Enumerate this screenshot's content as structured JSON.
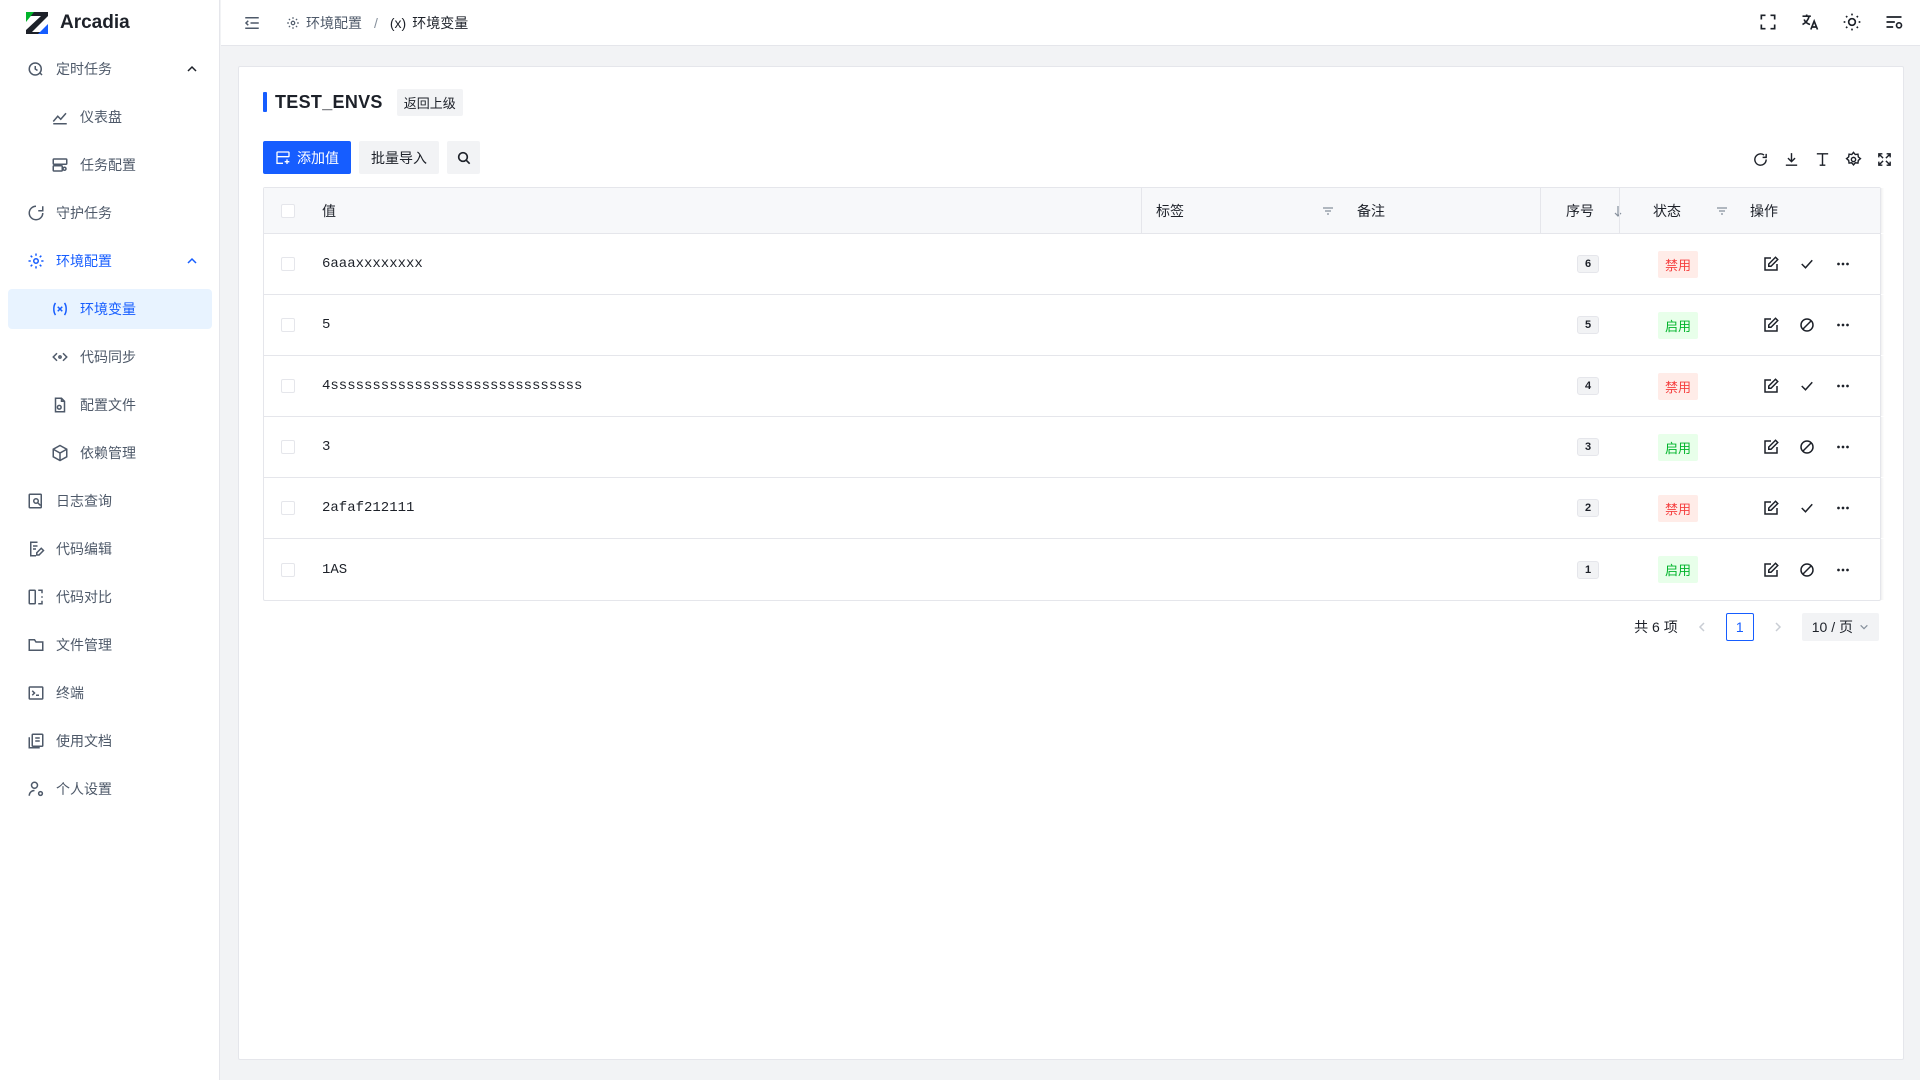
{
  "app": {
    "name": "Arcadia"
  },
  "sidebar": {
    "items": [
      {
        "label": "定时任务",
        "icon": "clock-icon"
      },
      {
        "label": "仪表盘",
        "icon": "chart-line-icon"
      },
      {
        "label": "任务配置",
        "icon": "server-icon"
      },
      {
        "label": "守护任务",
        "icon": "shield-icon"
      },
      {
        "label": "环境配置",
        "icon": "gear-icon"
      },
      {
        "label": "环境变量",
        "icon": "variable-icon"
      },
      {
        "label": "代码同步",
        "icon": "code-sync-icon"
      },
      {
        "label": "配置文件",
        "icon": "file-gear-icon"
      },
      {
        "label": "依赖管理",
        "icon": "package-icon"
      },
      {
        "label": "日志查询",
        "icon": "log-search-icon"
      },
      {
        "label": "代码编辑",
        "icon": "code-edit-icon"
      },
      {
        "label": "代码对比",
        "icon": "diff-icon"
      },
      {
        "label": "文件管理",
        "icon": "folder-icon"
      },
      {
        "label": "终端",
        "icon": "terminal-icon"
      },
      {
        "label": "使用文档",
        "icon": "docs-icon"
      },
      {
        "label": "个人设置",
        "icon": "user-gear-icon"
      }
    ]
  },
  "breadcrumb": {
    "parent": "环境配置",
    "current": "环境变量",
    "current_prefix": "(x)"
  },
  "page": {
    "title": "TEST_ENVS",
    "back_label": "返回上级"
  },
  "toolbar": {
    "add_label": "添加值",
    "import_label": "批量导入"
  },
  "table": {
    "headers": {
      "value": "值",
      "tag": "标签",
      "remark": "备注",
      "order": "序号",
      "status": "状态",
      "actions": "操作"
    },
    "rows": [
      {
        "value": "6aaaxxxxxxxx",
        "order": "6",
        "status": "禁用",
        "enabled": false
      },
      {
        "value": "5",
        "order": "5",
        "status": "启用",
        "enabled": true
      },
      {
        "value": "4ssssssssssssssssssssssssssssss",
        "order": "4",
        "status": "禁用",
        "enabled": false
      },
      {
        "value": "3",
        "order": "3",
        "status": "启用",
        "enabled": true
      },
      {
        "value": "2afaf212111",
        "order": "2",
        "status": "禁用",
        "enabled": false
      },
      {
        "value": "1AS",
        "order": "1",
        "status": "启用",
        "enabled": true
      }
    ]
  },
  "pagination": {
    "total": "共 6 项",
    "page": "1",
    "page_size": "10 / 页"
  },
  "colors": {
    "primary": "#165dff",
    "danger": "#f53f3f",
    "success": "#00b42a"
  }
}
